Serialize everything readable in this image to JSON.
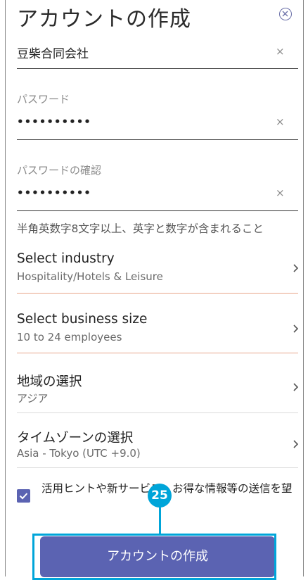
{
  "header": {
    "title": "アカウントの作成",
    "close_icon": "close-circle-icon"
  },
  "company_field": {
    "value": "豆柴合同会社",
    "clear_label": "×"
  },
  "password_field": {
    "label": "パスワード",
    "value": "••••••••••",
    "clear_label": "×"
  },
  "confirm_field": {
    "label": "パスワードの確認",
    "value": "••••••••••",
    "clear_label": "×"
  },
  "hint": "半角英数字8文字以上、英字と数字が含まれること",
  "selects": {
    "industry": {
      "title": "Select industry",
      "value": "Hospitality/Hotels & Leisure"
    },
    "business_size": {
      "title": "Select business size",
      "value": "10 to 24 employees"
    },
    "region": {
      "title": "地域の選択",
      "value": "アジア"
    },
    "timezone": {
      "title": "タイムゾーンの選択",
      "value": "Asia - Tokyo (UTC +9.0)"
    }
  },
  "opt_in": {
    "checked": true,
    "label": "活用ヒントや新サービス、お得な情報等の送信を望"
  },
  "callout": {
    "number": "25"
  },
  "submit_label": "アカウントの作成",
  "colors": {
    "accent": "#5b63b2",
    "callout": "#00a5d9",
    "error_line": "#e8a58a"
  }
}
